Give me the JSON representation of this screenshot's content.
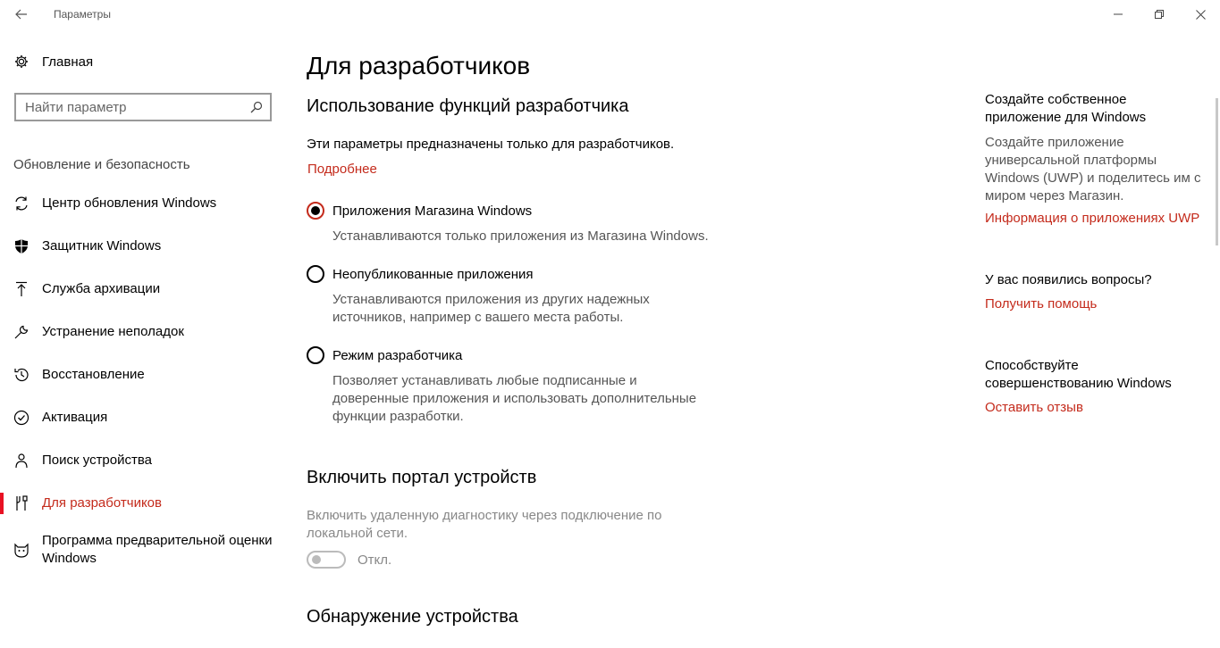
{
  "titlebar": {
    "title": "Параметры"
  },
  "sidebar": {
    "home_label": "Главная",
    "search_placeholder": "Найти параметр",
    "section_title": "Обновление и безопасность",
    "items": [
      {
        "label": "Центр обновления Windows",
        "icon": "refresh-icon",
        "active": false
      },
      {
        "label": "Защитник Windows",
        "icon": "shield-icon",
        "active": false
      },
      {
        "label": "Служба архивации",
        "icon": "upload-arrow-icon",
        "active": false
      },
      {
        "label": "Устранение неполадок",
        "icon": "wrench-icon",
        "active": false
      },
      {
        "label": "Восстановление",
        "icon": "history-icon",
        "active": false
      },
      {
        "label": "Активация",
        "icon": "check-circle-icon",
        "active": false
      },
      {
        "label": "Поиск устройства",
        "icon": "person-pin-icon",
        "active": false
      },
      {
        "label": "Для разработчиков",
        "icon": "tools-icon",
        "active": true
      },
      {
        "label": "Программа предварительной оценки Windows",
        "icon": "cat-icon",
        "active": false
      }
    ]
  },
  "main": {
    "page_title": "Для разработчиков",
    "section1": {
      "heading": "Использование функций разработчика",
      "intro": "Эти параметры предназначены только для разработчиков.",
      "more_link": "Подробнее",
      "options": [
        {
          "label": "Приложения Магазина Windows",
          "desc": "Устанавливаются только приложения из Магазина Windows.",
          "checked": true
        },
        {
          "label": "Неопубликованные приложения",
          "desc": "Устанавливаются приложения из других надежных источников, например с вашего места работы.",
          "checked": false
        },
        {
          "label": "Режим разработчика",
          "desc": "Позволяет устанавливать любые подписанные и доверенные приложения и использовать дополнительные функции разработки.",
          "checked": false
        }
      ]
    },
    "section2": {
      "heading": "Включить портал устройств",
      "desc": "Включить удаленную диагностику через подключение по локальной сети.",
      "toggle_label": "Откл.",
      "toggle_on": false
    },
    "section3": {
      "heading": "Обнаружение устройства"
    }
  },
  "aside": {
    "block1": {
      "title": "Создайте собственное приложение для Windows",
      "desc": "Создайте приложение универсальной платформы Windows (UWP) и поделитесь им с миром через Магазин.",
      "link": "Информация о приложениях UWP"
    },
    "block2": {
      "title": "У вас появились вопросы?",
      "link": "Получить помощь"
    },
    "block3": {
      "title": "Способствуйте совершенствованию Windows",
      "link": "Оставить отзыв"
    }
  },
  "colors": {
    "accent": "#c42b1c",
    "active_bar": "#e81123"
  }
}
